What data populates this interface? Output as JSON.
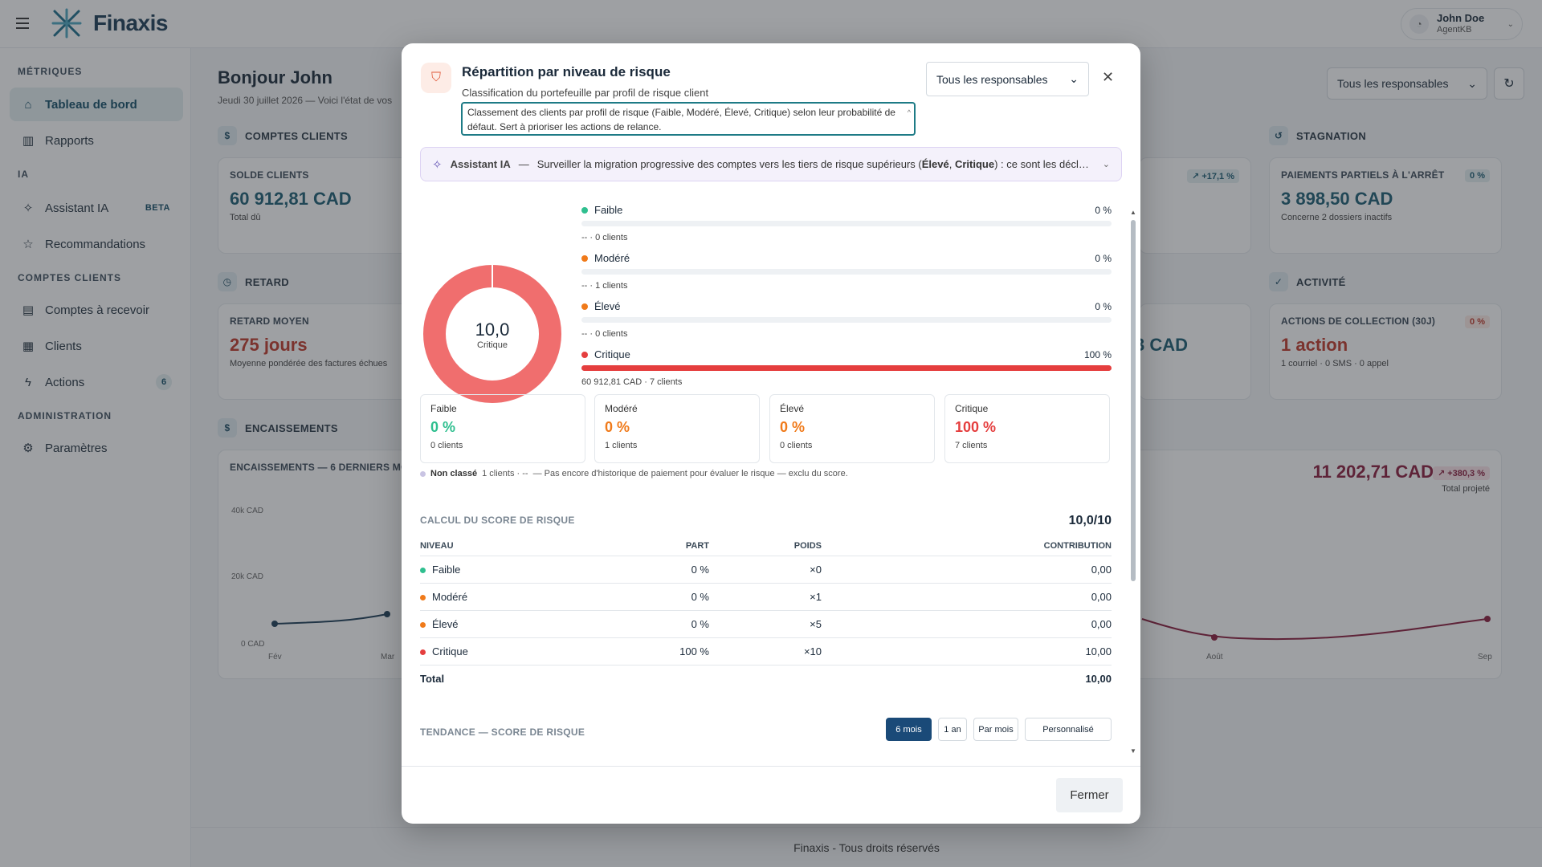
{
  "app": {
    "name": "Finaxis",
    "user_name": "John Doe",
    "user_sub": "AgentKB"
  },
  "nav": {
    "sections": [
      "MÉTRIQUES",
      "IA",
      "COMPTES CLIENTS",
      "ADMINISTRATION"
    ],
    "items": [
      {
        "label": "Tableau de bord",
        "icon": "home-icon"
      },
      {
        "label": "Rapports",
        "icon": "bar-chart-icon"
      },
      {
        "label": "Assistant IA",
        "icon": "sparkle-icon",
        "badge": "BETA"
      },
      {
        "label": "Recommandations",
        "icon": "star-icon"
      },
      {
        "label": "Comptes à recevoir",
        "icon": "document-icon"
      },
      {
        "label": "Clients",
        "icon": "building-icon"
      },
      {
        "label": "Actions",
        "icon": "bolt-icon",
        "badge": "6"
      },
      {
        "label": "Paramètres",
        "icon": "gear-icon"
      }
    ]
  },
  "dashboard": {
    "greeting": "Bonjour John",
    "date": "Jeudi 30 juillet 2026 — Voici l'état de vos",
    "responsables": "Tous les responsables",
    "sections": {
      "comptes": "COMPTES CLIENTS",
      "retard": "RETARD",
      "encaissements": "ENCAISSEMENTS",
      "stagnation": "STAGNATION",
      "activite": "ACTIVITÉ"
    },
    "solde": {
      "label": "SOLDE CLIENTS",
      "value": "60 912,81 CAD",
      "sub": "Total dû"
    },
    "retard": {
      "label": "RETARD MOYEN",
      "value": "275 jours",
      "sub": "Moyenne pondérée des factures échues"
    },
    "partiels": {
      "label": "PAIEMENTS PARTIELS À L'ARRÊT",
      "value": "3 898,50 CAD",
      "sub": "Concerne 2 dossiers inactifs",
      "pill": "0 %"
    },
    "actions": {
      "label": "ACTIONS DE COLLECTION (30J)",
      "value": "1 action",
      "sub": "1 courriel · 0 SMS · 0 appel",
      "pill": "0 %"
    },
    "pill_171": "↗ +17,1 %",
    "partial_value": "3 CAD",
    "enc": {
      "label": "ENCAISSEMENTS — 6 DERNIERS MOIS",
      "ticks": [
        "40k CAD",
        "20k CAD",
        "0 CAD"
      ],
      "months": [
        "Fév",
        "Mar",
        "Août",
        "Sep"
      ],
      "total": "11 202,71 CAD",
      "pill": "↗ +380,3 %",
      "total_sub": "Total projeté"
    },
    "footer": "Finaxis - Tous droits réservés"
  },
  "modal": {
    "title": "Répartition par niveau de risque",
    "subtitle": "Classification du portefeuille par profil de risque client",
    "description": "Classement des clients par profil de risque (Faible, Modéré, Élevé, Critique) selon leur probabilité de défaut. Sert à prioriser les actions de relance.",
    "responsables": "Tous les responsables",
    "ia_title": "Assistant IA",
    "ia_sep": "—",
    "ia_msg_a": "Surveiller la migration progressive des comptes vers les tiers de risque supérieurs (",
    "ia_msg_b": "Élevé",
    "ia_msg_c": ", ",
    "ia_msg_d": "Critique",
    "ia_msg_e": ") : ce sont les déclasse...",
    "donut": {
      "value": "10,0",
      "label": "Critique",
      "fraction": 1.0,
      "color": "#f06e6e"
    },
    "levels": [
      {
        "name": "Faible",
        "pct": "0 %",
        "sub": "-- · 0 clients",
        "fill": 0,
        "color": "#2fbf8f"
      },
      {
        "name": "Modéré",
        "pct": "0 %",
        "sub": "-- · 1 clients",
        "fill": 0,
        "color": "#f07a1a"
      },
      {
        "name": "Élevé",
        "pct": "0 %",
        "sub": "-- · 0 clients",
        "fill": 0,
        "color": "#f07a1a"
      },
      {
        "name": "Critique",
        "pct": "100 %",
        "sub": "60 912,81 CAD · 7 clients",
        "fill": 1,
        "color": "#e53e3e"
      }
    ],
    "cards": [
      {
        "name": "Faible",
        "pct": "0 %",
        "clients": "0 clients",
        "color": "#2fbf8f"
      },
      {
        "name": "Modéré",
        "pct": "0 %",
        "clients": "1 clients",
        "color": "#f07a1a"
      },
      {
        "name": "Élevé",
        "pct": "0 %",
        "clients": "0 clients",
        "color": "#f07a1a"
      },
      {
        "name": "Critique",
        "pct": "100 %",
        "clients": "7 clients",
        "color": "#e53e3e"
      }
    ],
    "non_classe": {
      "label": "Non classé",
      "detail": "1 clients · --",
      "note": "— Pas encore d'historique de paiement pour évaluer le risque — exclu du score."
    },
    "calc": {
      "title": "CALCUL DU SCORE DE RISQUE",
      "score": "10,0/10",
      "headers": [
        "NIVEAU",
        "PART",
        "POIDS",
        "CONTRIBUTION"
      ],
      "rows": [
        {
          "niveau": "Faible",
          "part": "0 %",
          "poids": "×0",
          "contribution": "0,00",
          "color": "#2fbf8f"
        },
        {
          "niveau": "Modéré",
          "part": "0 %",
          "poids": "×1",
          "contribution": "0,00",
          "color": "#f07a1a"
        },
        {
          "niveau": "Élevé",
          "part": "0 %",
          "poids": "×5",
          "contribution": "0,00",
          "color": "#f07a1a"
        },
        {
          "niveau": "Critique",
          "part": "100 %",
          "poids": "×10",
          "contribution": "10,00",
          "color": "#e53e3e"
        }
      ],
      "total_label": "Total",
      "total_value": "10,00"
    },
    "trend": {
      "title": "TENDANCE — SCORE DE RISQUE",
      "options": [
        "6 mois",
        "1 an",
        "Par mois",
        "Personnalisé"
      ],
      "selected": "6 mois"
    },
    "close_label": "Fermer"
  }
}
